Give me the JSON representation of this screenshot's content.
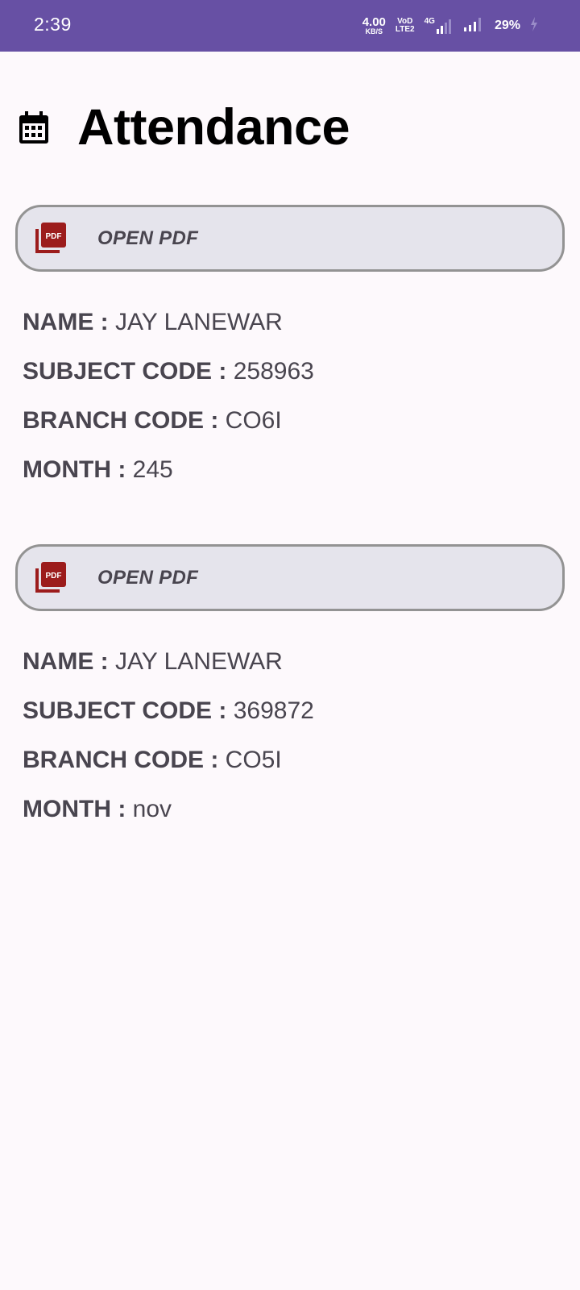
{
  "status_bar": {
    "time": "2:39",
    "net_speed_value": "4.00",
    "net_speed_unit": "KB/S",
    "volte_top": "VoD",
    "volte_bottom": "LTE2",
    "network_type": "4G",
    "battery": "29%"
  },
  "header": {
    "title": "Attendance",
    "icon": "calendar-icon"
  },
  "colors": {
    "status_bar": "#6750a4",
    "background": "#fdf9fc",
    "button_bg": "#e5e4ec",
    "button_border": "#939393",
    "pdf_icon": "#9c1c1c",
    "text": "#49454f"
  },
  "records": [
    {
      "button_label": "OPEN PDF",
      "button_icon": "pdf-icon",
      "fields": [
        {
          "label": "NAME :",
          "value": "JAY LANEWAR"
        },
        {
          "label": "SUBJECT CODE :",
          "value": "258963"
        },
        {
          "label": "BRANCH CODE :",
          "value": "CO6I"
        },
        {
          "label": "MONTH :",
          "value": "245"
        }
      ]
    },
    {
      "button_label": "OPEN PDF",
      "button_icon": "pdf-icon",
      "fields": [
        {
          "label": "NAME :",
          "value": "JAY LANEWAR"
        },
        {
          "label": "SUBJECT CODE :",
          "value": "369872"
        },
        {
          "label": "BRANCH CODE :",
          "value": "CO5I"
        },
        {
          "label": "MONTH :",
          "value": "nov"
        }
      ]
    }
  ]
}
